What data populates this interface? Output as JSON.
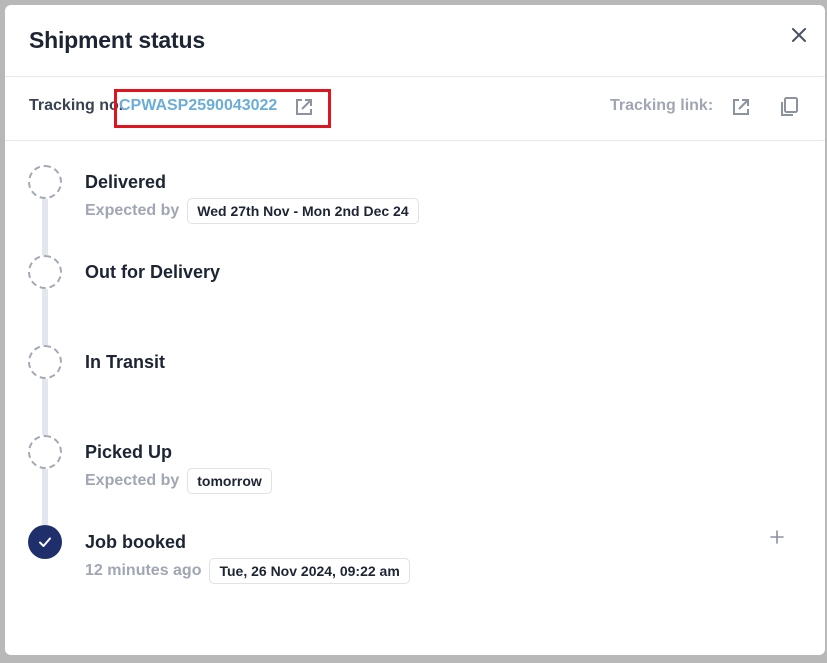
{
  "modal": {
    "title": "Shipment status"
  },
  "tracking": {
    "label": "Tracking no.",
    "number": "CPWASP2590043022",
    "link_label": "Tracking link:"
  },
  "timeline": {
    "steps": [
      {
        "title": "Delivered",
        "sub_label": "Expected by",
        "chip": "Wed 27th Nov - Mon 2nd Dec 24",
        "status": "pending"
      },
      {
        "title": "Out for Delivery",
        "status": "pending"
      },
      {
        "title": "In Transit",
        "status": "pending"
      },
      {
        "title": "Picked Up",
        "sub_label": "Expected by",
        "chip": "tomorrow",
        "status": "pending"
      },
      {
        "title": "Job booked",
        "sub_label": "12 minutes ago",
        "chip": "Tue, 26 Nov 2024, 09:22 am",
        "status": "done"
      }
    ]
  },
  "colors": {
    "accent": "#6aaed8",
    "highlight": "#e0141e",
    "done": "#1f2f6b",
    "muted": "#a0a6b3",
    "text": "#1d2433"
  },
  "icons": {
    "close": "close-icon",
    "open": "external-link-icon",
    "copy": "copy-icon",
    "check": "check-icon",
    "add": "plus-icon"
  }
}
